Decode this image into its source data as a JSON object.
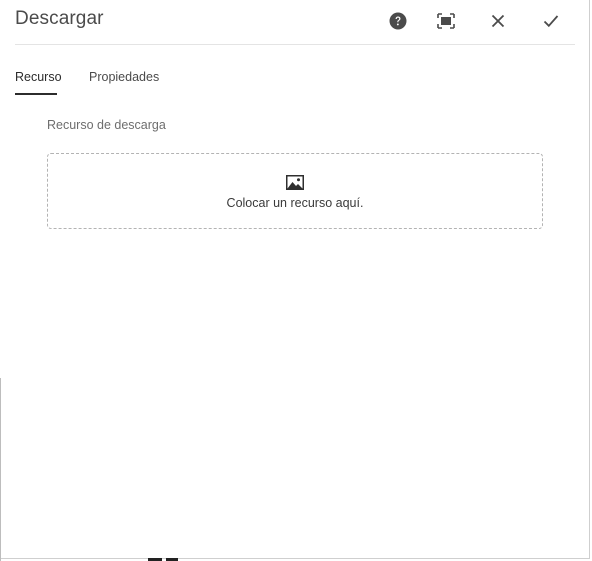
{
  "dialog": {
    "title": "Descargar",
    "actions": {
      "help_icon": "help-circle-icon",
      "fullscreen_icon": "fullscreen-icon",
      "cancel_icon": "close-icon",
      "confirm_icon": "checkmark-icon"
    }
  },
  "tabs": [
    {
      "label": "Recurso",
      "active": true
    },
    {
      "label": "Propiedades",
      "active": false
    }
  ],
  "asset_field": {
    "label": "Recurso de descarga",
    "drop_icon": "image-icon",
    "drop_text": "Colocar un recurso aquí."
  },
  "colors": {
    "text": "#4b4b4b",
    "active_tab_underline": "#2c2c2c",
    "dropzone_border": "#b3b3b3"
  }
}
